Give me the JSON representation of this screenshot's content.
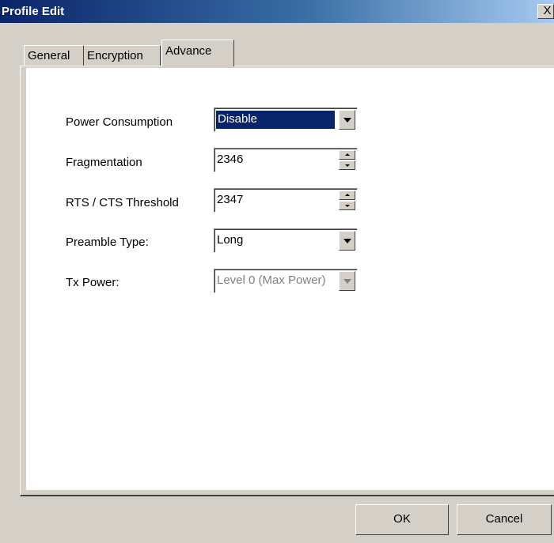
{
  "window": {
    "title": "Profile Edit",
    "close_glyph": "X"
  },
  "tabs": [
    {
      "label": "General"
    },
    {
      "label": "Encryption"
    },
    {
      "label": "Advance"
    }
  ],
  "form": {
    "power_consumption": {
      "label": "Power Consumption",
      "value": "Disable"
    },
    "fragmentation": {
      "label": "Fragmentation",
      "value": "2346"
    },
    "rts_cts": {
      "label": "RTS / CTS Threshold",
      "value": "2347"
    },
    "preamble": {
      "label": "Preamble Type:",
      "value": "Long"
    },
    "tx_power": {
      "label": "Tx Power:",
      "value": "Level 0 (Max Power)"
    }
  },
  "buttons": {
    "ok": "OK",
    "cancel": "Cancel"
  },
  "icons": {
    "close": "close-icon",
    "dropdown": "chevron-down-icon",
    "spin_up": "spin-up-icon",
    "spin_down": "spin-down-icon"
  }
}
